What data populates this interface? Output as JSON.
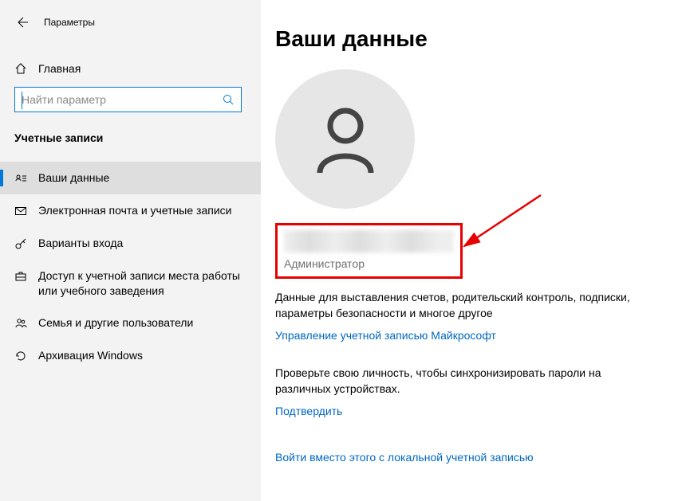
{
  "window_title": "Параметры",
  "home_label": "Главная",
  "search_placeholder": "Найти параметр",
  "section_title": "Учетные записи",
  "nav": [
    {
      "label": "Ваши данные",
      "icon": "user-card-icon",
      "selected": true
    },
    {
      "label": "Электронная почта и учетные записи",
      "icon": "mail-icon",
      "selected": false
    },
    {
      "label": "Варианты входа",
      "icon": "key-icon",
      "selected": false
    },
    {
      "label": "Доступ к учетной записи места работы или учебного заведения",
      "icon": "briefcase-icon",
      "selected": false
    },
    {
      "label": "Семья и другие пользователи",
      "icon": "people-icon",
      "selected": false
    },
    {
      "label": "Архивация Windows",
      "icon": "refresh-icon",
      "selected": false
    }
  ],
  "page_title": "Ваши данные",
  "account_role": "Администратор",
  "billing_desc": "Данные для выставления счетов, родительский контроль, подписки, параметры безопасности и многое другое",
  "manage_link": "Управление учетной записью Майкрософт",
  "verify_desc": "Проверьте свою личность, чтобы синхронизировать пароли на различных устройствах.",
  "verify_link": "Подтвердить",
  "local_link": "Войти вместо этого с локальной учетной записью"
}
